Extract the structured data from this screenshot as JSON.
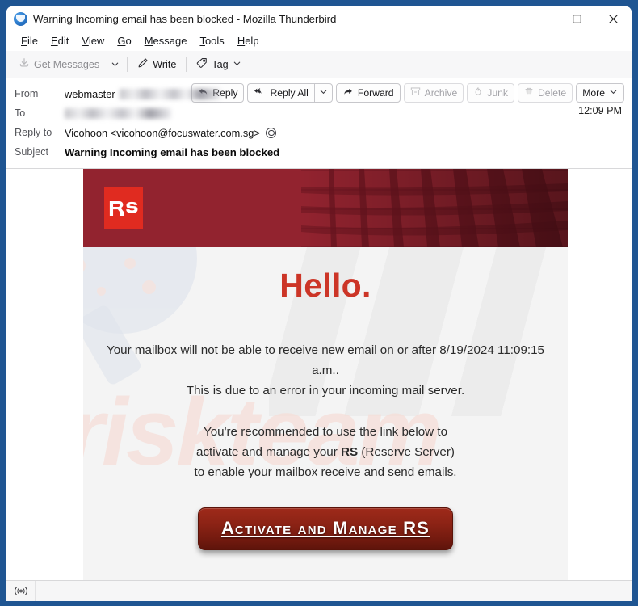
{
  "window": {
    "title": "Warning Incoming email has been blocked - Mozilla Thunderbird",
    "app_icon": "thunderbird-icon",
    "minimize_label": "–",
    "maximize_label": "□",
    "close_label": "✕"
  },
  "menubar": {
    "items": [
      {
        "label": "File",
        "accel": "F"
      },
      {
        "label": "Edit",
        "accel": "E"
      },
      {
        "label": "View",
        "accel": "V"
      },
      {
        "label": "Go",
        "accel": "G"
      },
      {
        "label": "Message",
        "accel": "M"
      },
      {
        "label": "Tools",
        "accel": "T"
      },
      {
        "label": "Help",
        "accel": "H"
      }
    ]
  },
  "toolbar": {
    "get_messages": "Get Messages",
    "write": "Write",
    "tag": "Tag",
    "icons": [
      "download-icon",
      "chevron-down-icon",
      "pencil-icon",
      "tag-icon",
      "chevron-down-icon"
    ]
  },
  "message_header": {
    "from_label": "From",
    "from_value": "webmaster",
    "from_redacted": true,
    "to_label": "To",
    "to_value": "",
    "to_redacted": true,
    "reply_to_label": "Reply to",
    "reply_to_value": "Vicohoon <vicohoon@focuswater.com.sg>",
    "subject_label": "Subject",
    "subject_value": "Warning Incoming email has been blocked",
    "time": "12:09 PM",
    "actions": [
      {
        "name": "reply",
        "label": "Reply",
        "icon": "reply-icon",
        "disabled": false
      },
      {
        "name": "reply-all",
        "label": "Reply All",
        "icon": "reply-all-icon",
        "disabled": false
      },
      {
        "name": "reply-dropdown",
        "label": "",
        "icon": "chevron-down-icon",
        "disabled": false
      },
      {
        "name": "forward",
        "label": "Forward",
        "icon": "forward-icon",
        "disabled": false
      },
      {
        "name": "archive",
        "label": "Archive",
        "icon": "archive-icon",
        "disabled": true
      },
      {
        "name": "junk",
        "label": "Junk",
        "icon": "flame-icon",
        "disabled": true
      },
      {
        "name": "delete",
        "label": "Delete",
        "icon": "trash-icon",
        "disabled": true
      },
      {
        "name": "more",
        "label": "More",
        "icon": "chevron-down-icon",
        "disabled": false
      }
    ]
  },
  "email": {
    "brand_logo_text": "RS",
    "banner_color": "#92232f",
    "logo_color": "#e02b20",
    "heading": "Hello.",
    "heading_color": "#cc3527",
    "paragraph1_line1": "Your mailbox will not be able to receive new email on or after 8/19/2024 11:09:15",
    "paragraph1_line2": "a.m..",
    "paragraph1_line3": "This is due to an error in your incoming mail server.",
    "paragraph2_line1": "You're recommended to use the link below to",
    "paragraph2_line2_pre": "activate and manage your ",
    "paragraph2_line2_bold": "RS",
    "paragraph2_line2_post": " (Reserve Server)",
    "paragraph2_line3": "to enable your mailbox receive and send emails.",
    "cta_label": "Activate and Manage RS",
    "watermark_text": "riskteam"
  },
  "statusbar": {
    "icon": "broadcast-icon",
    "text": ""
  }
}
